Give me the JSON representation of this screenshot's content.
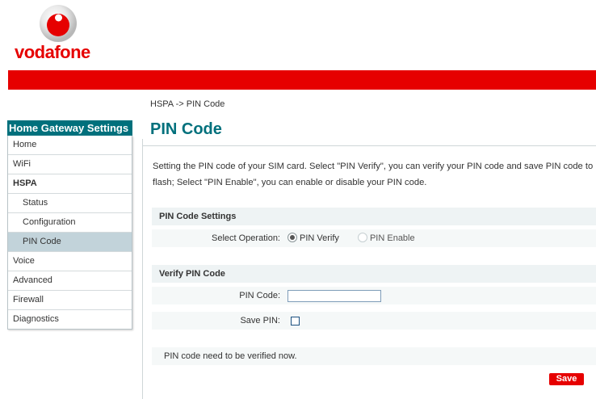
{
  "brand": {
    "name": "vodafone",
    "color": "#e60000",
    "accent": "#00707c"
  },
  "breadcrumb": "HSPA -> PIN Code",
  "sidebar": {
    "title": "Home Gateway Settings",
    "items": [
      {
        "label": "Home"
      },
      {
        "label": "WiFi"
      },
      {
        "label": "HSPA"
      },
      {
        "label": "Status"
      },
      {
        "label": "Configuration"
      },
      {
        "label": "PIN Code"
      },
      {
        "label": "Voice"
      },
      {
        "label": "Advanced"
      },
      {
        "label": "Firewall"
      },
      {
        "label": "Diagnostics"
      }
    ],
    "active": "PIN Code"
  },
  "main": {
    "title": "PIN Code",
    "description": "Setting the PIN code of your SIM card. Select \"PIN Verify\", you can verify your PIN code and save PIN code to flash; Select \"PIN Enable\", you can enable or disable your PIN code.",
    "pin_settings": {
      "heading": "PIN Code Settings",
      "operation_label": "Select Operation:",
      "options": [
        "PIN Verify",
        "PIN Enable"
      ],
      "selected": "PIN Verify"
    },
    "verify": {
      "heading": "Verify PIN Code",
      "pin_label": "PIN Code:",
      "pin_value": "",
      "save_label": "Save PIN:",
      "save_checked": false
    },
    "status": "PIN code need to be verified now.",
    "save_button": "Save"
  }
}
